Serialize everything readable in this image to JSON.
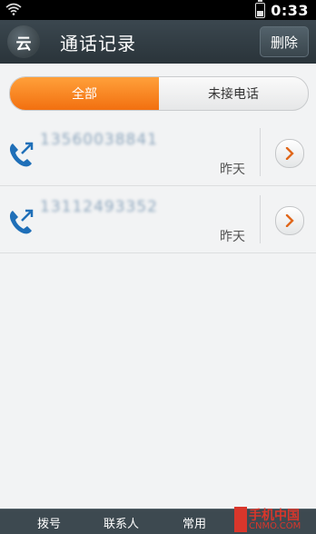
{
  "status": {
    "time": "0:33"
  },
  "header": {
    "title": "通话记录",
    "delete_label": "删除",
    "app_icon_glyph": "云"
  },
  "tabs": [
    {
      "label": "全部",
      "selected": true
    },
    {
      "label": "未接电话",
      "selected": false
    }
  ],
  "calls": [
    {
      "number": "13560038841",
      "date": "昨天"
    },
    {
      "number": "13112493352",
      "date": "昨天"
    }
  ],
  "bottom_nav": [
    {
      "label": "拨号"
    },
    {
      "label": "联系人"
    },
    {
      "label": "常用"
    }
  ],
  "watermark": {
    "main": "手机中国",
    "sub": "CNMO.COM"
  },
  "colors": {
    "accent": "#f27010",
    "header": "#2f3a40",
    "call_icon": "#1f6fb8"
  }
}
